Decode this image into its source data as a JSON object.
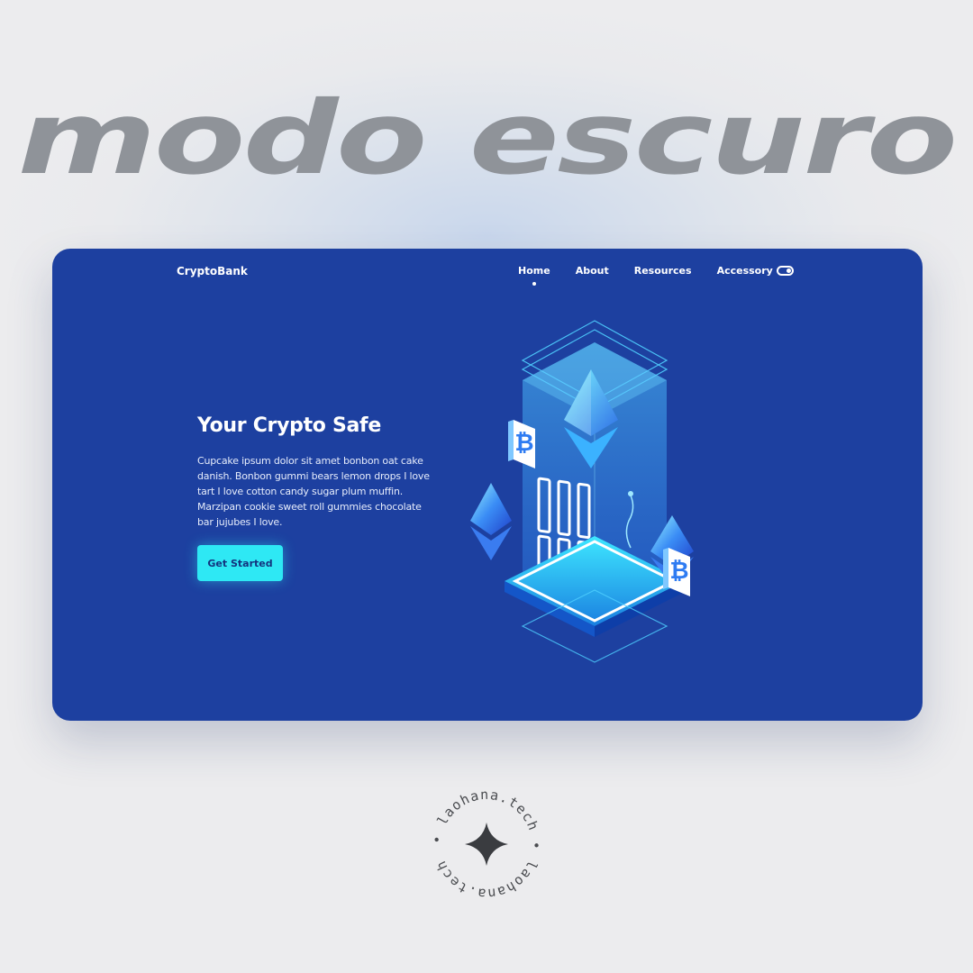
{
  "headline": "modo escuro",
  "app": {
    "brand": "CryptoBank",
    "nav": [
      {
        "label": "Home",
        "active": true
      },
      {
        "label": "About",
        "active": false
      },
      {
        "label": "Resources",
        "active": false
      },
      {
        "label": "Accessory",
        "active": false
      }
    ],
    "theme_toggle_icon": "toggle-switch-icon"
  },
  "hero": {
    "title": "Your Crypto Safe",
    "body": "Cupcake ipsum dolor sit amet bonbon oat cake danish. Bonbon gummi bears lemon drops I love tart I love cotton candy sugar plum muffin. Marzipan cookie sweet roll gummies chocolate bar jujubes I love.",
    "cta_label": "Get Started",
    "illustration_icons": [
      "ethereum-icon",
      "bitcoin-icon",
      "server-tower-icon"
    ]
  },
  "stamp": {
    "text": "• laohana.tech • laohana.tech ",
    "icon": "four-point-star-icon"
  },
  "colors": {
    "card_background": "#1d40a0",
    "accent_cyan": "#2ee8f4",
    "headline_gray": "#8f9399",
    "page_background": "#ececee"
  }
}
